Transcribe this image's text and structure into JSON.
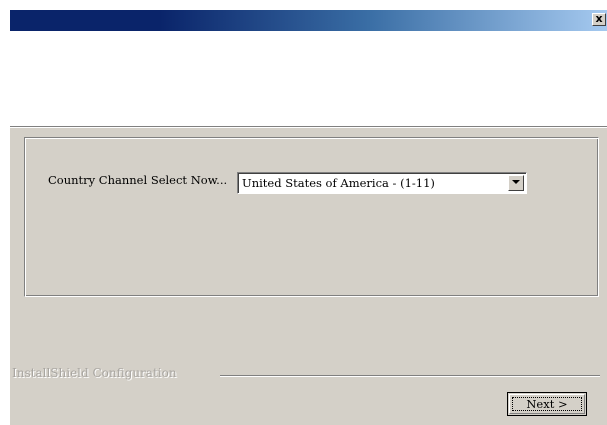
{
  "window": {
    "title": "",
    "close_glyph": "x",
    "title_gradient": [
      "#0a246a",
      "#a6caf0"
    ],
    "face_color": "#d4d0c8"
  },
  "form": {
    "channel_label": "Country Channel Select Now...",
    "channel_select": {
      "value": "United States of America - (1-11)",
      "arrow_icon": "chevron-down-icon"
    }
  },
  "footer": {
    "brand_text": "InstallShield Configuration",
    "next_button_label": "Next >"
  }
}
